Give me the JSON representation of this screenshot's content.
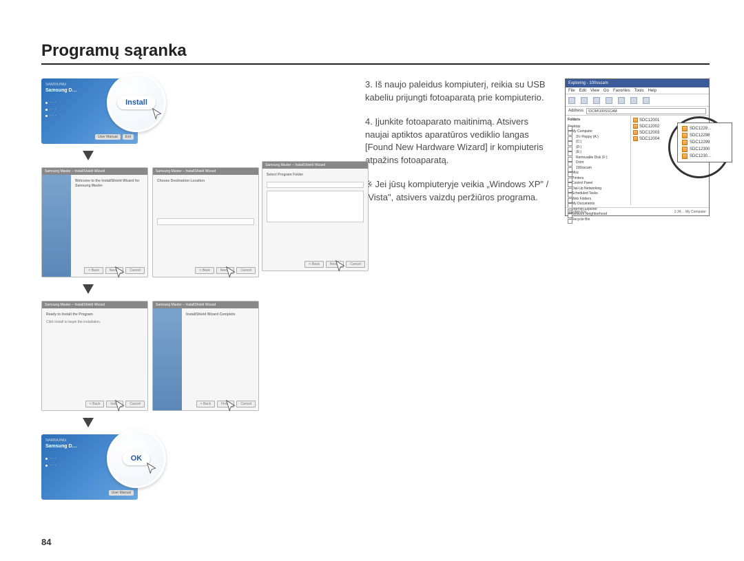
{
  "page_title": "Programų sąranka",
  "page_number": "84",
  "steps": {
    "s3": "3. Iš naujo paleidus kompiuterį, reikia su USB kabeliu prijungti fotoaparatą prie kompiuterio.",
    "s4": "4. Įjunkite fotoaparato maitinimą. Atsivers naujai aptiktos aparatūros vediklio langas [Found New Hardware Wizard] ir kompiuteris atpažins fotoaparatą."
  },
  "note": "※ Jei jūsų kompiuteryje veikia „Windows XP\" / „Vista\", atsivers vaizdų peržiūros programa.",
  "installer": {
    "brand": "SAMSUNG",
    "title": "Samsung D…",
    "install_label": "Install",
    "ok_label": "OK",
    "btn_user_manual": "User Manual",
    "btn_exit": "Exit"
  },
  "wizard": {
    "title_generic": "Samsung Master – InstallShield Wizard",
    "welcome": "Welcome to the InstallShield Wizard for Samsung Master",
    "dest_head": "Choose Destination Location",
    "folder_head": "Select Program Folder",
    "ready_head": "Ready to Install the Program",
    "ready_sub": "Click Install to begin the installation.",
    "complete_head": "InstallShield Wizard Complete",
    "btn_back": "< Back",
    "btn_next": "Next >",
    "btn_cancel": "Cancel",
    "btn_install": "Install",
    "btn_finish": "Finish"
  },
  "explorer": {
    "title": "Exploring - 100sscam",
    "menus": [
      "File",
      "Edit",
      "View",
      "Go",
      "Favorites",
      "Tools",
      "Help"
    ],
    "toolbar": [
      "Back",
      "Forward",
      "Up",
      "Cut",
      "Copy",
      "Paste",
      "Undo"
    ],
    "address_label": "Address",
    "address_value": "\\DCIM\\100SSCAM",
    "tree_label": "Folders",
    "tree": [
      "Desktop",
      "My Computer",
      "3½ Floppy (A:)",
      "(C:)",
      "(D:)",
      "(E:)",
      "Removable Disk (F:)",
      "Dcim",
      "100sscam",
      "Misc",
      "Printers",
      "Control Panel",
      "Dial-Up Networking",
      "Scheduled Tasks",
      "Web Folders",
      "My Documents",
      "Internet Explorer",
      "Network Neighborhood",
      "Recycle Bin"
    ],
    "files_left": [
      "SDC12001",
      "SDC12002",
      "SDC12003",
      "SDC12004"
    ],
    "files_callout": [
      "SDC1229…",
      "SDC12298",
      "SDC12299",
      "SDC12300",
      "SDC1230…"
    ],
    "status_left": "10 object(s)",
    "status_right": "2.34… My Computer"
  }
}
